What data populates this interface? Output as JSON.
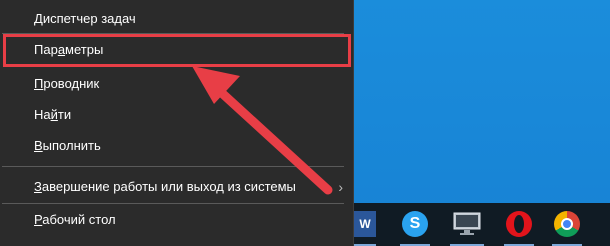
{
  "menu": {
    "items": [
      {
        "pre": "",
        "ul": "Д",
        "post": "испетчер задач"
      },
      {
        "pre": "Пар",
        "ul": "а",
        "post": "метры"
      },
      {
        "pre": "",
        "ul": "П",
        "post": "роводник"
      },
      {
        "pre": "На",
        "ul": "й",
        "post": "ти"
      },
      {
        "pre": "",
        "ul": "В",
        "post": "ыполнить"
      },
      {
        "pre": "",
        "ul": "З",
        "post": "авершение работы или выход из системы"
      },
      {
        "pre": "",
        "ul": "Р",
        "post": "абочий стол"
      }
    ],
    "submenu_chevron": "›",
    "highlight_color": "#e83e46"
  },
  "taskbar": {
    "icons": [
      "word-icon",
      "skype-icon",
      "monitor-icon",
      "opera-icon",
      "chrome-icon"
    ],
    "word_label": "W",
    "skype_label": "S"
  }
}
